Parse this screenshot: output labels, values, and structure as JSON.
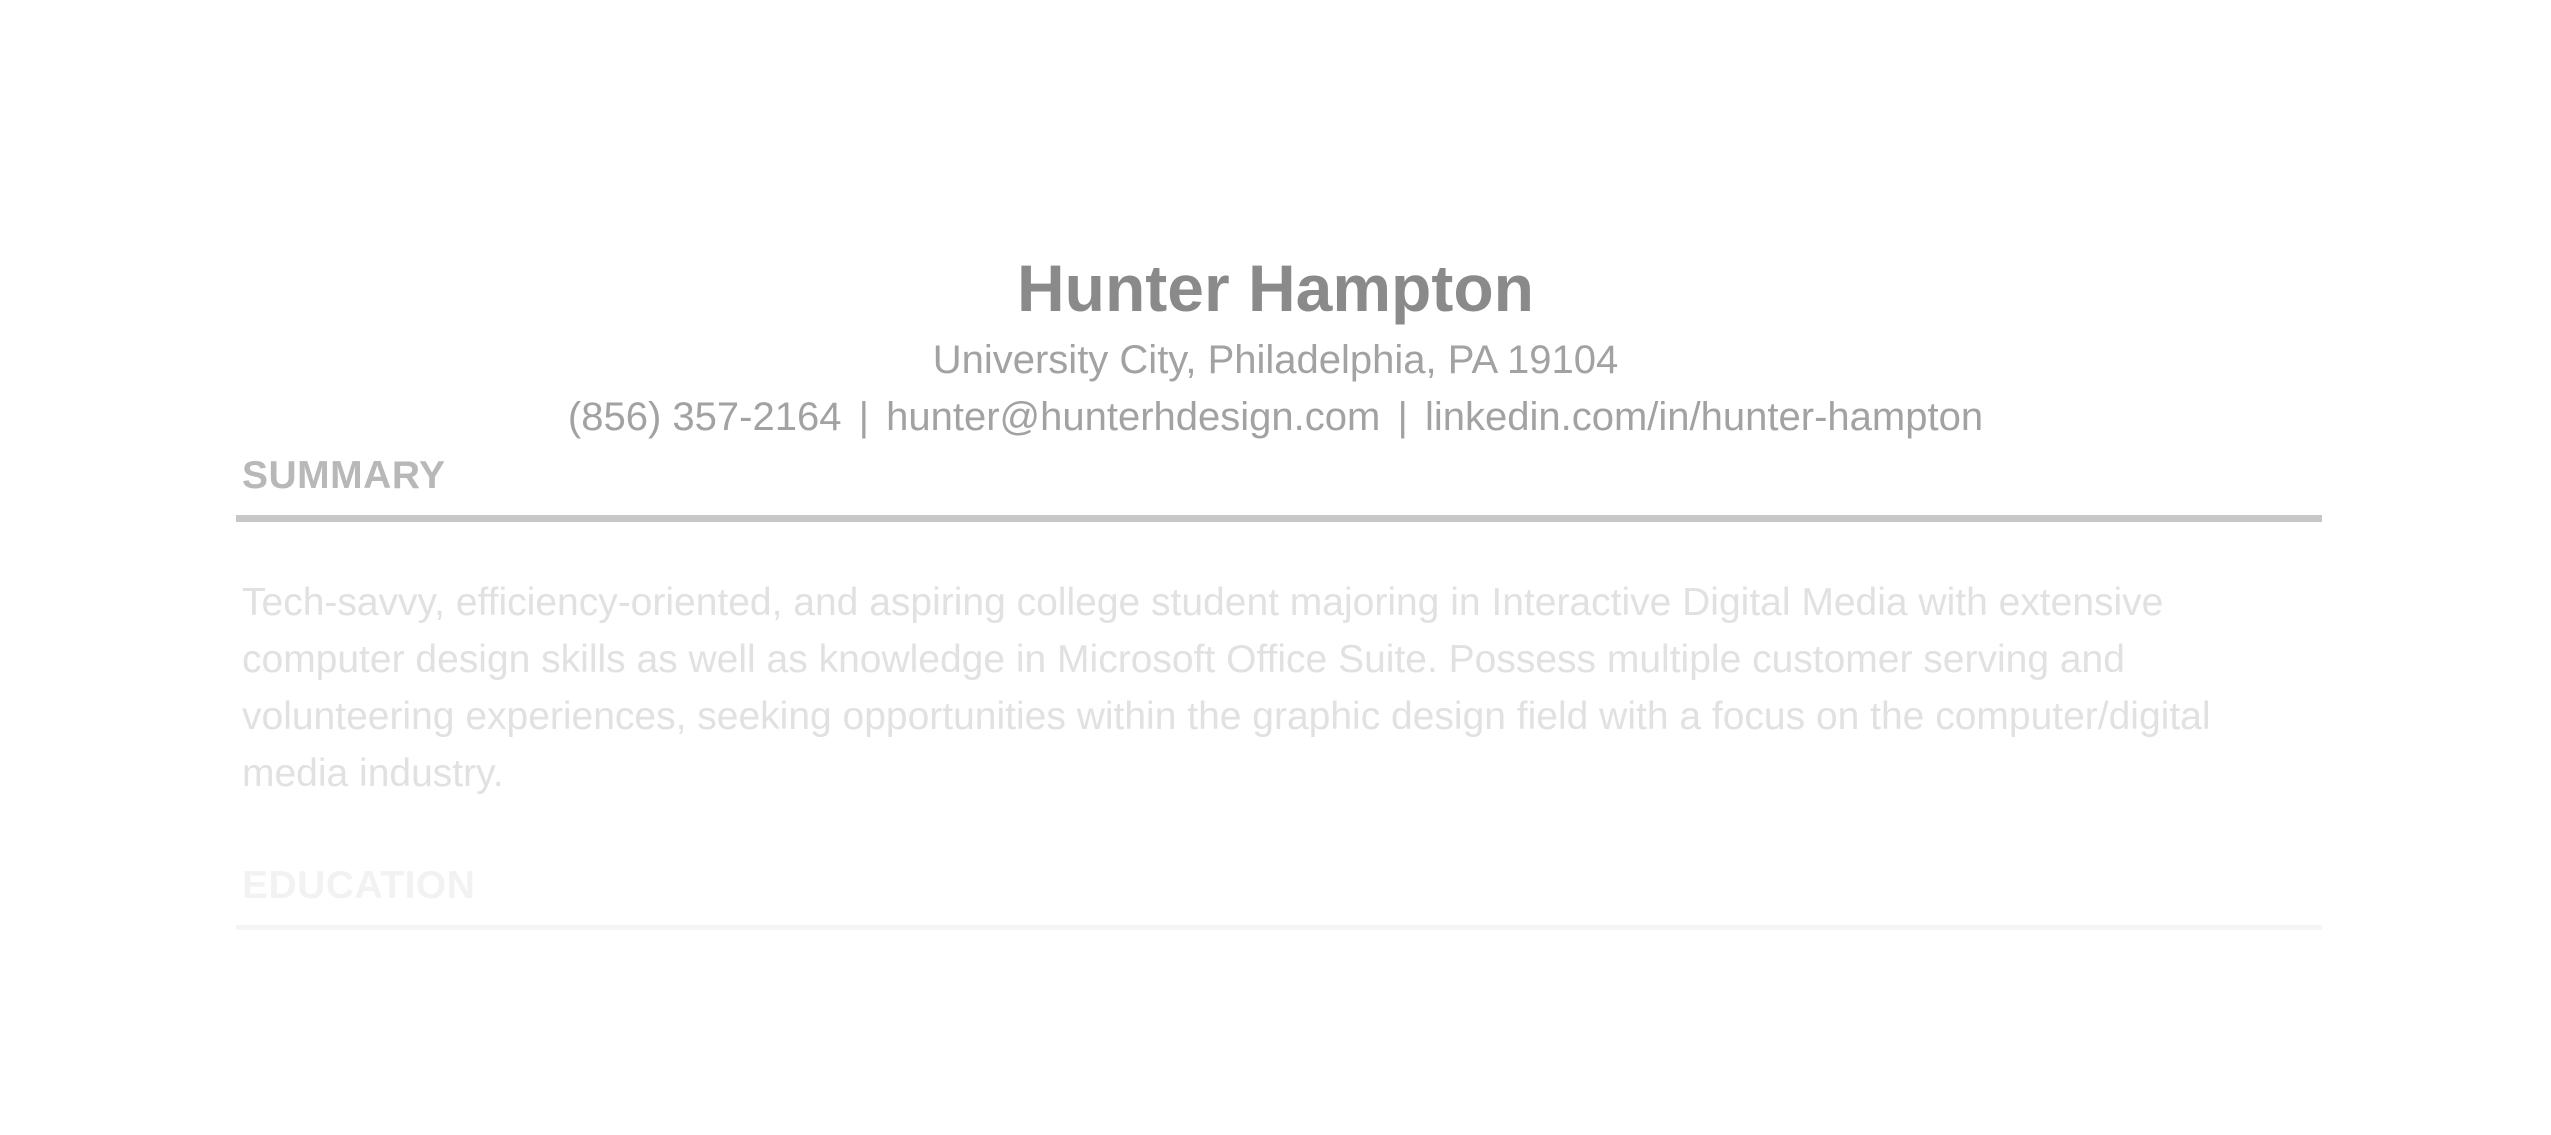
{
  "header": {
    "name": "Hunter Hampton",
    "address": "University City, Philadelphia, PA 19104",
    "contact": {
      "phone": "(856) 357-2164",
      "separator": "|",
      "email": "hunter@hunterhdesign.com",
      "linkedin": "linkedin.com/in/hunter-hampton"
    }
  },
  "summary": {
    "title": "SUMMARY",
    "text": "Tech-savvy, efficiency-oriented, and aspiring college student majoring in Interactive Digital Media with extensive computer design skills as well as knowledge in Microsoft Office Suite. Possess multiple customer serving and volunteering experiences, seeking opportunities within the graphic design field with a focus on the computer/digital media industry."
  },
  "education": {
    "title": "EDUCATION"
  },
  "colors": {
    "name": "#8a8a8a",
    "subtext": "#a2a2a2",
    "section_title": "#b8b8b8",
    "rule": "#c7c7c7",
    "body_text_faded": "#e1e1e1"
  }
}
